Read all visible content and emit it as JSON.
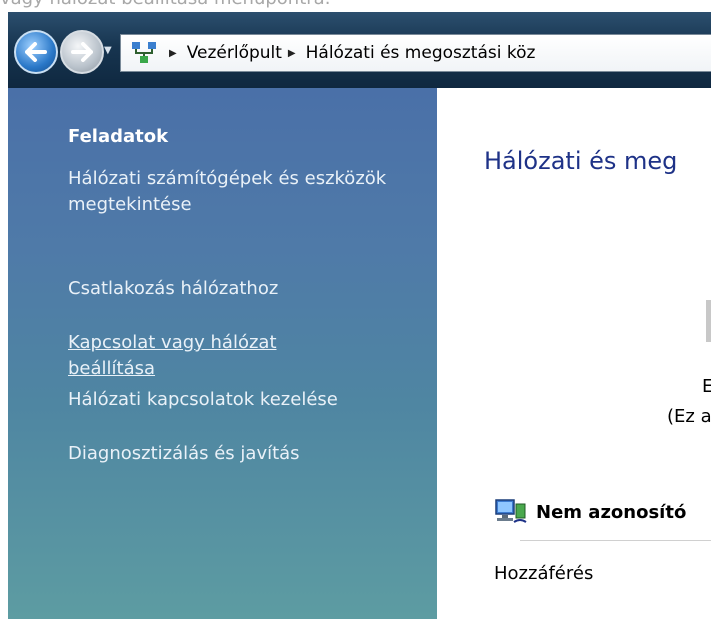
{
  "top_instruction": "vagy hálózat beállítása menüpontra.",
  "breadcrumb": {
    "items": [
      "Vezérlőpult",
      "Hálózati és megosztási köz"
    ]
  },
  "sidebar": {
    "title": "Feladatok",
    "tasks": [
      {
        "label": "Hálózati számítógépek és eszközök megtekintése"
      },
      {
        "label": "Csatlakozás hálózathoz"
      },
      {
        "label": "Kapcsolat vagy hálózat beállítása"
      },
      {
        "label": "Hálózati kapcsolatok kezelése"
      },
      {
        "label": "Diagnosztizálás és javítás"
      }
    ]
  },
  "main": {
    "title": "Hálózati és meg",
    "map_text_1": "E",
    "map_text_2": "(Ez a",
    "network_name": "Nem azonosító",
    "access_label": "Hozzáférés"
  },
  "icons": {
    "back": "back-arrow-icon",
    "forward": "forward-arrow-icon",
    "network_location": "network-center-icon",
    "network": "network-computer-icon"
  },
  "colors": {
    "pane_top": "#4a70a8",
    "pane_bottom": "#5d9ca2",
    "title_blue": "#1e3287",
    "navbar": "#173550"
  }
}
